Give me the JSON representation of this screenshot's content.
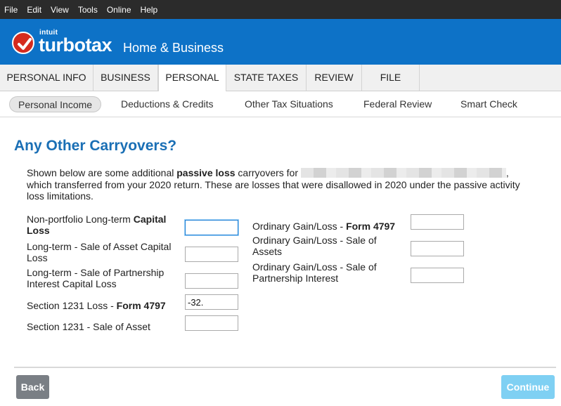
{
  "menu": [
    "File",
    "Edit",
    "View",
    "Tools",
    "Online",
    "Help"
  ],
  "brand": {
    "intuit": "intuit",
    "product": "turbotax",
    "edition": "Home & Business"
  },
  "tabs": [
    "PERSONAL INFO",
    "BUSINESS",
    "PERSONAL",
    "STATE TAXES",
    "REVIEW",
    "FILE"
  ],
  "active_tab": "PERSONAL",
  "subtabs": [
    "Personal Income",
    "Deductions & Credits",
    "Other Tax Situations",
    "Federal Review",
    "Smart Check"
  ],
  "active_subtab": "Personal Income",
  "page_title": "Any Other Carryovers?",
  "intro": {
    "part1": "Shown below are some additional ",
    "bold": "passive loss",
    "part2": " carryovers for ",
    "part3": ", which transferred from your 2020 return. These are losses that were disallowed in 2020 under the passive activity loss limitations."
  },
  "left_fields": [
    {
      "label": "Non-portfolio Long-term ",
      "bold": "Capital Loss",
      "value": ""
    },
    {
      "label": "Long-term - Sale of Asset Capital Loss",
      "bold": "",
      "value": ""
    },
    {
      "label": "Long-term - Sale of Partnership Interest Capital Loss",
      "bold": "",
      "value": ""
    },
    {
      "label": "Section 1231 Loss - ",
      "bold": "Form 4797",
      "value": "-32."
    },
    {
      "label": "Section 1231 - Sale of Asset",
      "bold": "",
      "value": ""
    }
  ],
  "right_fields": [
    {
      "label": "Ordinary Gain/Loss - ",
      "bold": "Form 4797",
      "value": ""
    },
    {
      "label": "Ordinary Gain/Loss - Sale of Assets",
      "bold": "",
      "value": ""
    },
    {
      "label": "Ordinary Gain/Loss - Sale of Partnership Interest",
      "bold": "",
      "value": ""
    }
  ],
  "buttons": {
    "back": "Back",
    "continue": "Continue"
  },
  "colors": {
    "brand_blue": "#0d72c7",
    "title_blue": "#1a6fb5",
    "logo_red": "#d52b1e",
    "continue_blue": "#7fd0f3",
    "back_gray": "#7a7f85"
  }
}
